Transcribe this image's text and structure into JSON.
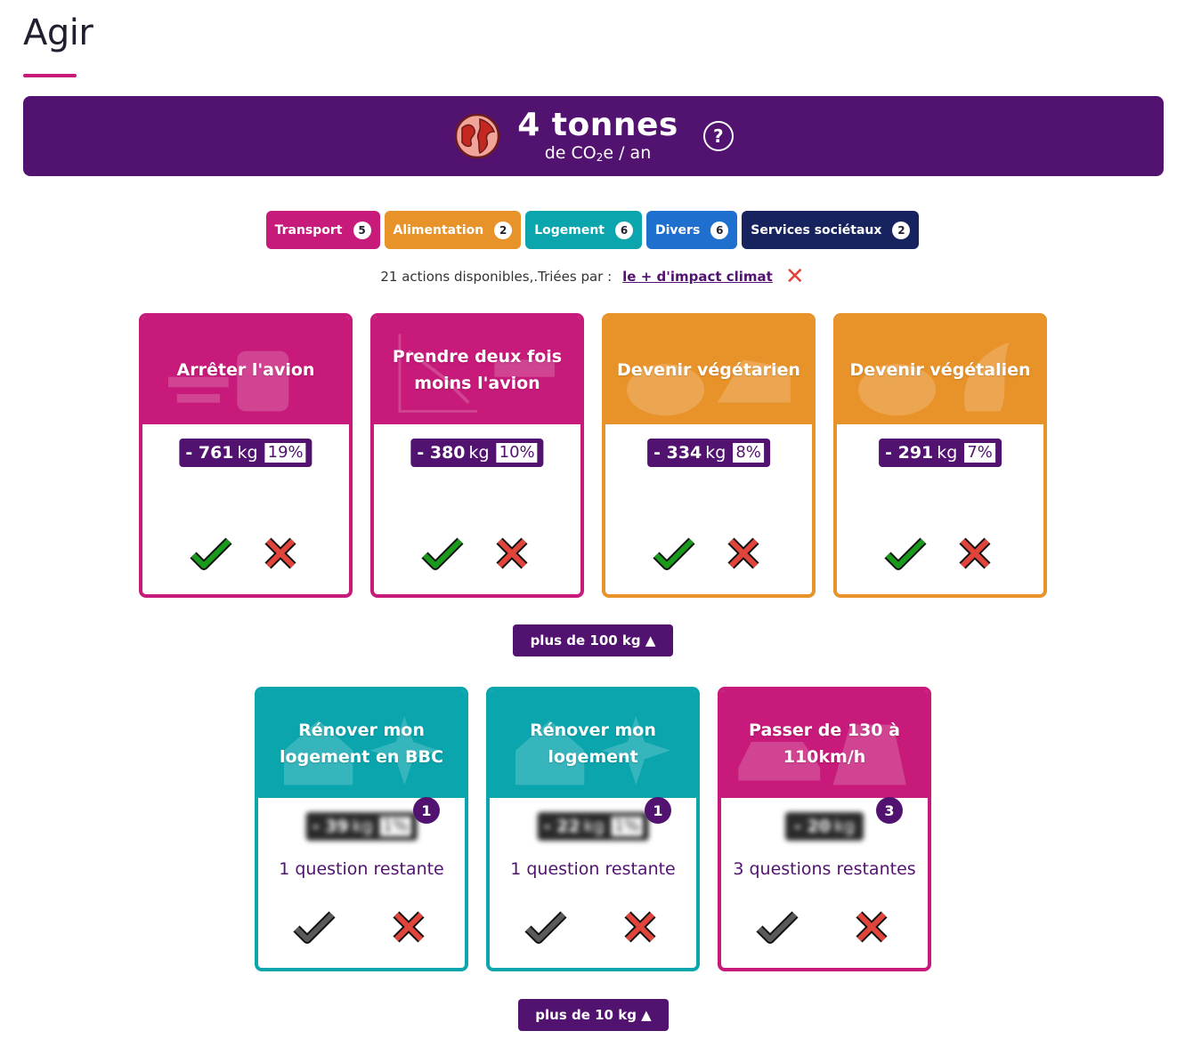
{
  "page": {
    "title": "Agir"
  },
  "banner": {
    "value": "4 tonnes",
    "unit_prefix": "de CO",
    "unit_sub": "2",
    "unit_suffix": "e / an",
    "help": "?"
  },
  "categories": [
    {
      "label": "Transport",
      "count": "5",
      "color": "#c71a7a"
    },
    {
      "label": "Alimentation",
      "count": "2",
      "color": "#e8922a"
    },
    {
      "label": "Logement",
      "count": "6",
      "color": "#0aa5ad"
    },
    {
      "label": "Divers",
      "count": "6",
      "color": "#1e6fce"
    },
    {
      "label": "Services sociétaux",
      "count": "2",
      "color": "#17235e"
    }
  ],
  "sort": {
    "text": "21 actions disponibles,.Triées par :",
    "link": "le + d'impact climat"
  },
  "cards_top": [
    {
      "title": "Arrêter l'avion",
      "kg": "- 761",
      "unit": "kg",
      "pct": "19%",
      "color": "#c71a7a"
    },
    {
      "title": "Prendre deux fois moins l'avion",
      "kg": "- 380",
      "unit": "kg",
      "pct": "10%",
      "color": "#c71a7a"
    },
    {
      "title": "Devenir végétarien",
      "kg": "- 334",
      "unit": "kg",
      "pct": "8%",
      "color": "#e8922a"
    },
    {
      "title": "Devenir végétalien",
      "kg": "- 291",
      "unit": "kg",
      "pct": "7%",
      "color": "#e8922a"
    }
  ],
  "more_100": "plus de 100 kg ▲",
  "cards_bottom": [
    {
      "title": "Rénover mon logement en BBC",
      "kg": "- 39",
      "unit": "kg",
      "pct": "1%",
      "questions": "1",
      "remaining": "1 question restante",
      "color": "#0aa5ad"
    },
    {
      "title": "Rénover mon logement",
      "kg": "- 22",
      "unit": "kg",
      "pct": "1%",
      "questions": "1",
      "remaining": "1 question restante",
      "color": "#0aa5ad"
    },
    {
      "title": "Passer de 130 à 110km/h",
      "kg": "- 20",
      "unit": "kg",
      "pct": "",
      "questions": "3",
      "remaining": "3 questions restantes",
      "color": "#c71a7a"
    }
  ],
  "more_10": "plus de 10 kg ▲"
}
